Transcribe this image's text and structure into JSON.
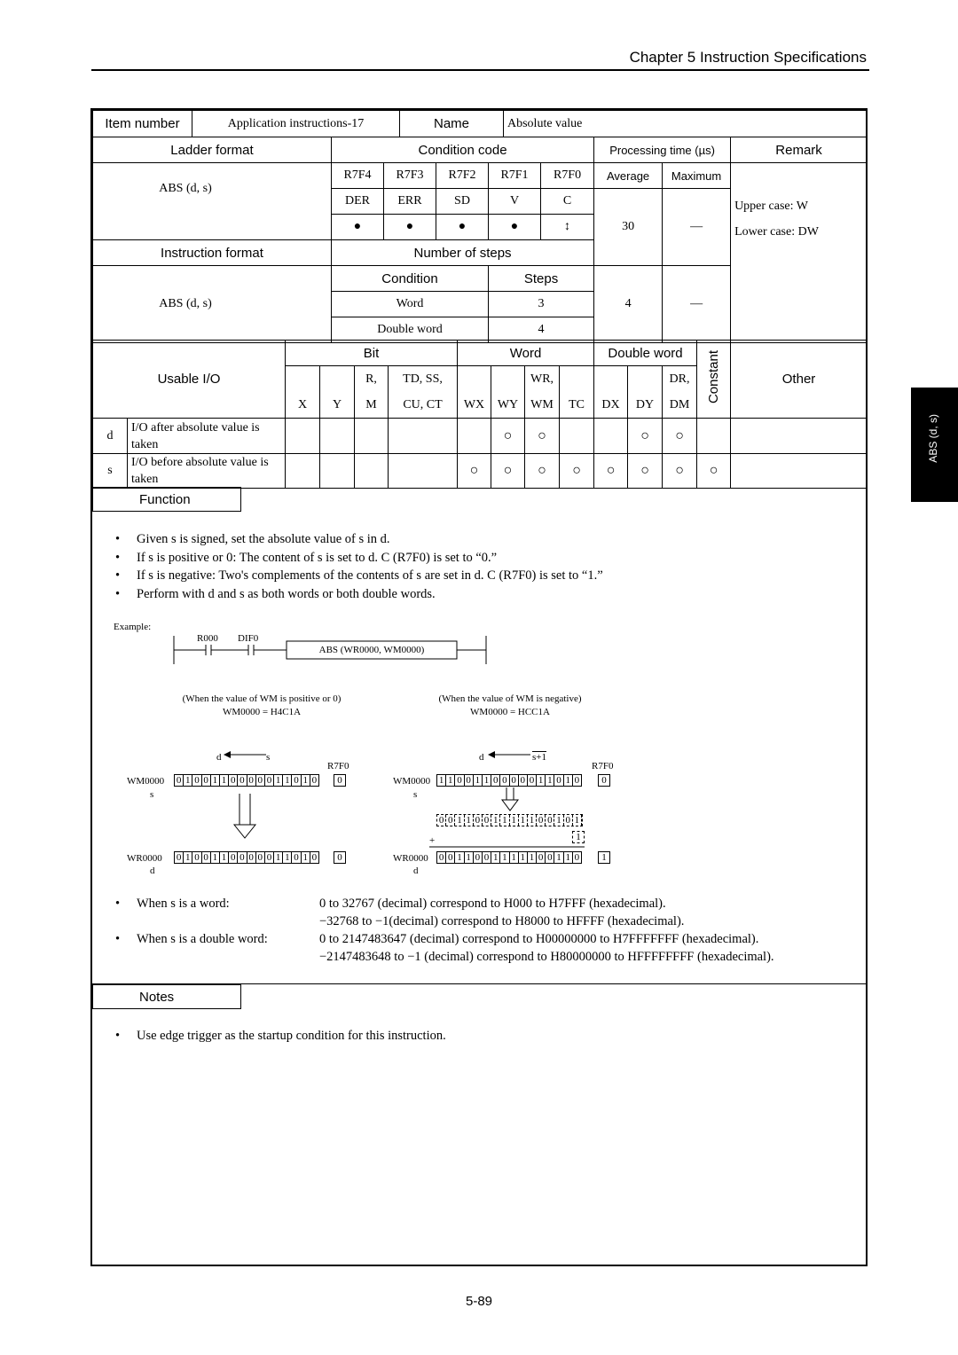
{
  "header": {
    "chapter": "Chapter 5  Instruction Specifications"
  },
  "side_tab": "ABS (d, s)",
  "item": {
    "item_label": "Item number",
    "item_value": "Application instructions-17",
    "name_label": "Name",
    "name_value": "Absolute value"
  },
  "spec": {
    "ladder_label": "Ladder format",
    "condition_label": "Condition code",
    "processing_label": "Processing time (µs)",
    "remark_label": "Remark",
    "flags": [
      "R7F4",
      "R7F3",
      "R7F2",
      "R7F1",
      "R7F0"
    ],
    "flag_names": [
      "DER",
      "ERR",
      "SD",
      "V",
      "C"
    ],
    "flag_states": [
      "●",
      "●",
      "●",
      "●",
      "↕"
    ],
    "average_label": "Average",
    "maximum_label": "Maximum",
    "ladder_value": "ABS (d, s)",
    "avg_time": "30",
    "max_time": "—",
    "remark_lines": [
      "Upper case: W",
      "Lower case: DW"
    ],
    "instr_label": "Instruction format",
    "steps_label": "Number of steps",
    "instr_value": "ABS (d, s)",
    "cond_label": "Condition",
    "steps_col": "Steps",
    "steps": [
      {
        "condition": "Word",
        "steps": "3"
      },
      {
        "condition": "Double word",
        "steps": "4"
      }
    ],
    "avg_steps": "4",
    "max_steps": "—"
  },
  "io": {
    "label": "Usable I/O",
    "groups": [
      "Bit",
      "Word",
      "Double word"
    ],
    "constant": "Constant",
    "other": "Other",
    "cols": [
      "X",
      "Y",
      "R,\nM",
      "TD, SS,\nCU, CT",
      "WX",
      "WY",
      "WR,\nWM",
      "TC",
      "DX",
      "DY",
      "DR,\nDM"
    ],
    "cols_top": [
      "",
      "",
      "R,",
      "TD, SS,",
      "",
      "",
      "WR,",
      "",
      "",
      "",
      "DR,"
    ],
    "cols_bot": [
      "X",
      "Y",
      "M",
      "CU, CT",
      "WX",
      "WY",
      "WM",
      "TC",
      "DX",
      "DY",
      "DM"
    ],
    "rows": [
      {
        "param": "d",
        "desc": "I/O after absolute value is taken",
        "marks": [
          "",
          "",
          "",
          "",
          "",
          "○",
          "○",
          "",
          "",
          "○",
          "○",
          ""
        ]
      },
      {
        "param": "s",
        "desc": "I/O before absolute value is taken",
        "marks": [
          "",
          "",
          "",
          "",
          "○",
          "○",
          "○",
          "○",
          "○",
          "○",
          "○",
          "○"
        ]
      }
    ]
  },
  "function": {
    "label": "Function",
    "bullets": [
      "Given s is signed, set the absolute value of s in d.",
      "If s is positive or 0: The content of s is set to d.  C (R7F0) is set to “0.”",
      "If s is negative: Two's complements of the contents of s are set in d.  C (R7F0) is set to “1.”",
      "Perform with d and s as both words or both double words."
    ]
  },
  "example": {
    "label": "Example:",
    "contact1": "R000",
    "contact2": "DIF0",
    "instruction": "ABS (WR0000, WM0000)",
    "pos": {
      "caption": "(When the value of WM is positive or 0)",
      "value": "WM0000 = H4C1A",
      "d": "d",
      "s": "s",
      "flag": "R7F0",
      "src_reg": "WM0000",
      "src_bits": "0100110000011010",
      "src_flag": "0",
      "dst_reg": "WR0000",
      "dst_bits": "0100110000011010",
      "dst_flag": "0",
      "src_sub": "s",
      "dst_sub": "d"
    },
    "neg": {
      "caption": "(When the value of WM is negative)",
      "value": "WM0000 = HCC1A",
      "d": "d",
      "s": "s+1",
      "flag": "R7F0",
      "src_reg": "WM0000",
      "src_bits": "1100110000011010",
      "src_flag": "0",
      "inv_bits": "0011001111100101",
      "plus_bit": "1",
      "plus": "+",
      "dst_reg": "WR0000",
      "dst_bits": "0011001111100110",
      "dst_flag": "1",
      "src_sub": "s",
      "dst_sub": "d"
    }
  },
  "ranges": [
    {
      "label": "When s is a word:",
      "lines": [
        "0 to 32767 (decimal) correspond to H000 to H7FFF (hexadecimal).",
        "−32768 to −1(decimal) correspond to H8000 to HFFFF (hexadecimal)."
      ]
    },
    {
      "label": "When s is a double word:",
      "lines": [
        "0 to 2147483647 (decimal) correspond to H00000000 to H7FFFFFFF (hexadecimal).",
        "−2147483648 to −1 (decimal) correspond to H80000000 to HFFFFFFFF (hexadecimal)."
      ]
    }
  ],
  "notes": {
    "label": "Notes",
    "bullets": [
      "Use edge trigger as the startup condition for this instruction."
    ]
  },
  "page_number": "5-89"
}
